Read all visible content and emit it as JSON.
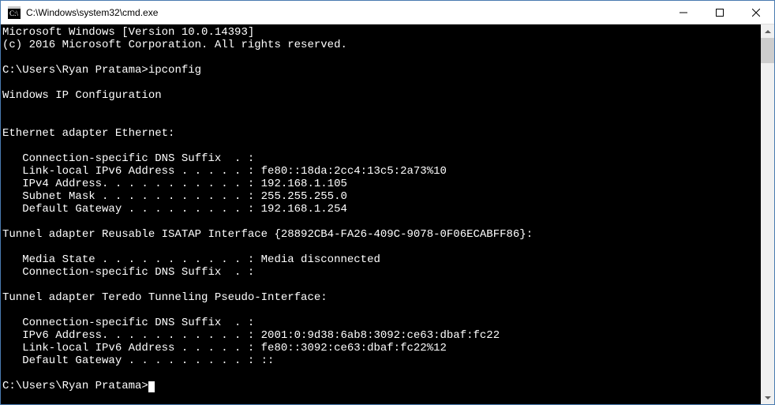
{
  "window": {
    "title": "C:\\Windows\\system32\\cmd.exe"
  },
  "output": {
    "banner1": "Microsoft Windows [Version 10.0.14393]",
    "banner2": "(c) 2016 Microsoft Corporation. All rights reserved.",
    "prompt1": "C:\\Users\\Ryan Pratama>",
    "command1": "ipconfig",
    "header": "Windows IP Configuration",
    "adapter1_title": "Ethernet adapter Ethernet:",
    "adapter1_dns": "   Connection-specific DNS Suffix  . :",
    "adapter1_linklocal": "   Link-local IPv6 Address . . . . . : fe80::18da:2cc4:13c5:2a73%10",
    "adapter1_ipv4": "   IPv4 Address. . . . . . . . . . . : 192.168.1.105",
    "adapter1_mask": "   Subnet Mask . . . . . . . . . . . : 255.255.255.0",
    "adapter1_gateway": "   Default Gateway . . . . . . . . . : 192.168.1.254",
    "adapter2_title": "Tunnel adapter Reusable ISATAP Interface {28892CB4-FA26-409C-9078-0F06ECABFF86}:",
    "adapter2_media": "   Media State . . . . . . . . . . . : Media disconnected",
    "adapter2_dns": "   Connection-specific DNS Suffix  . :",
    "adapter3_title": "Tunnel adapter Teredo Tunneling Pseudo-Interface:",
    "adapter3_dns": "   Connection-specific DNS Suffix  . :",
    "adapter3_ipv6": "   IPv6 Address. . . . . . . . . . . : 2001:0:9d38:6ab8:3092:ce63:dbaf:fc22",
    "adapter3_linklocal": "   Link-local IPv6 Address . . . . . : fe80::3092:ce63:dbaf:fc22%12",
    "adapter3_gateway": "   Default Gateway . . . . . . . . . : ::",
    "prompt2": "C:\\Users\\Ryan Pratama>"
  }
}
